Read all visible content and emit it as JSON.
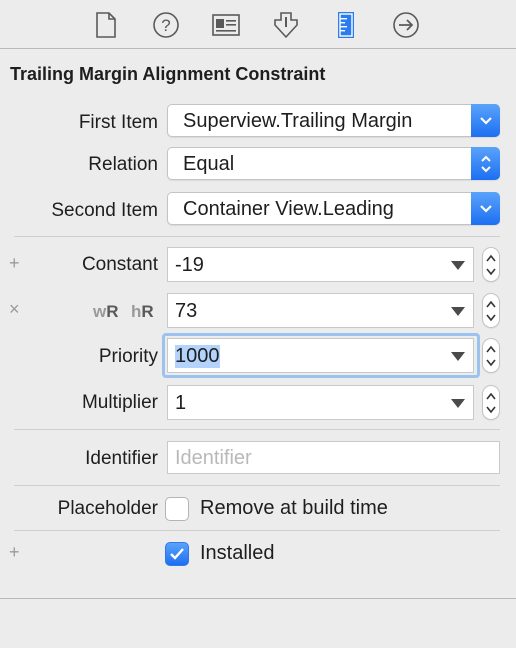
{
  "toolbar": {
    "tabs": [
      {
        "icon": "file-inspector-icon",
        "active": false
      },
      {
        "icon": "quick-help-icon",
        "active": false
      },
      {
        "icon": "identity-inspector-icon",
        "active": false
      },
      {
        "icon": "attributes-inspector-icon",
        "active": false
      },
      {
        "icon": "size-inspector-icon",
        "active": true
      },
      {
        "icon": "connections-inspector-icon",
        "active": false
      }
    ],
    "accent_color": "#2a7cf0"
  },
  "title": "Trailing Margin Alignment Constraint",
  "first_item": {
    "label": "First Item",
    "value": "Superview.Trailing Margin"
  },
  "relation": {
    "label": "Relation",
    "value": "Equal"
  },
  "second_item": {
    "label": "Second Item",
    "value": "Container View.Leading"
  },
  "constant": {
    "marker": "+",
    "label": "Constant",
    "value": "-19"
  },
  "size_class": {
    "marker": "×",
    "w": "w",
    "w_value": "R",
    "h": "h",
    "h_value": "R",
    "value": "73"
  },
  "priority": {
    "label": "Priority",
    "value": "1000"
  },
  "multiplier": {
    "label": "Multiplier",
    "value": "1"
  },
  "identifier": {
    "label": "Identifier",
    "placeholder": "Identifier"
  },
  "placeholder": {
    "label": "Placeholder",
    "checkbox_label": "Remove at build time",
    "checked": false
  },
  "installed": {
    "marker": "+",
    "checkbox_label": "Installed",
    "checked": true
  }
}
